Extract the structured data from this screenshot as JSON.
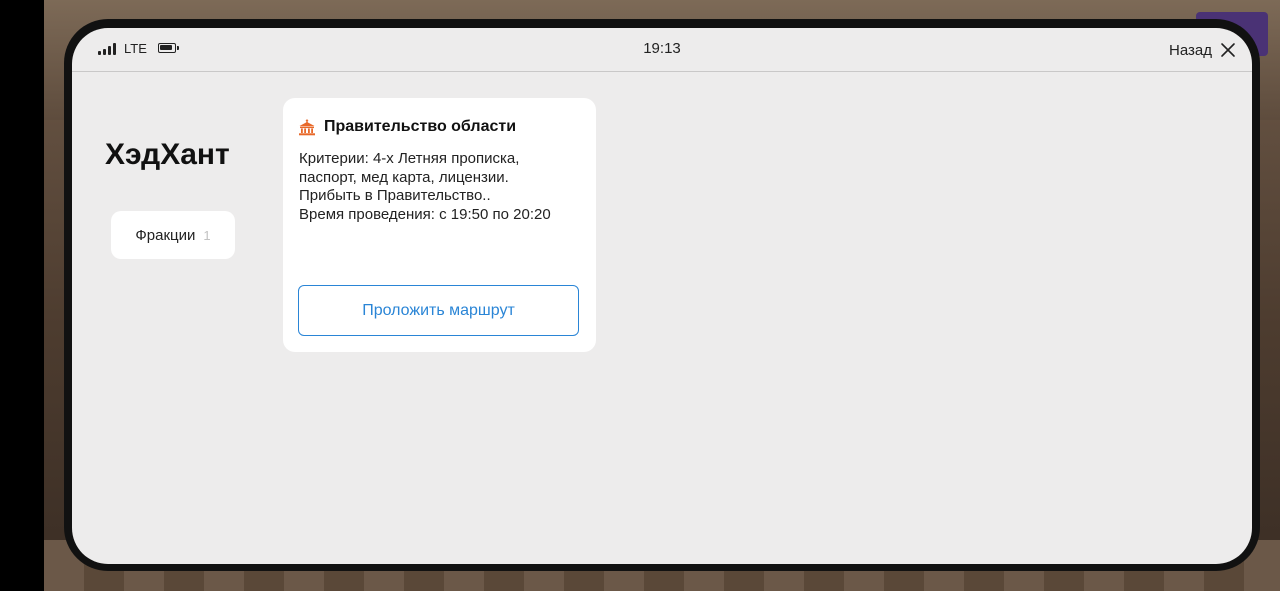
{
  "status_bar": {
    "network": "LTE",
    "time": "19:13",
    "back_label": "Назад",
    "icons": [
      "signal-icon",
      "battery-icon",
      "close-icon"
    ]
  },
  "page": {
    "title": "ХэдХант"
  },
  "tabs": [
    {
      "label": "Фракции",
      "count": "1"
    }
  ],
  "event_card": {
    "icon": "government-building-icon",
    "title": "Правительство области",
    "description_lines": [
      "Критерии: 4-х Летняя прописка,",
      "паспорт, мед карта, лицензии.",
      "Прибыть в Правительство..",
      "Время проведения: с 19:50 по 20:20"
    ],
    "route_button_label": "Проложить маршрут"
  },
  "colors": {
    "screen_bg": "#edecec",
    "card_bg": "#ffffff",
    "accent_blue": "#2a85d6",
    "icon_orange": "#e8692a"
  }
}
